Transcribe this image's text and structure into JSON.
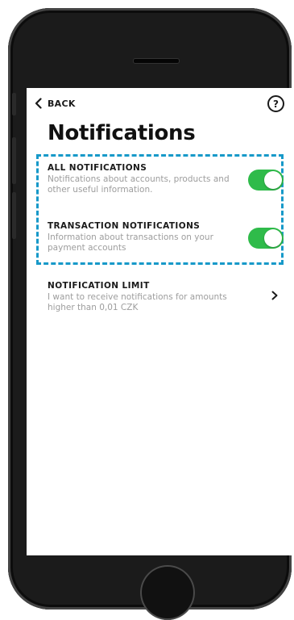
{
  "header": {
    "back_label": "BACK",
    "help_symbol": "?",
    "title": "Notifications"
  },
  "settings": [
    {
      "title": "ALL NOTIFICATIONS",
      "description": "Notifications about accounts, products and other useful information.",
      "control": "toggle",
      "enabled": true
    },
    {
      "title": "TRANSACTION NOTIFICATIONS",
      "description": "Information about transactions on your payment accounts",
      "control": "toggle",
      "enabled": true
    },
    {
      "title": "NOTIFICATION LIMIT",
      "description": "I want to receive notifications for amounts higher than 0,01 CZK",
      "control": "chevron-right-icon"
    }
  ],
  "colors": {
    "toggle_on": "#2fbb4a",
    "highlight_border": "#1799c9",
    "text_primary": "#1a1a1a",
    "text_secondary": "#9d9d9d"
  },
  "icons": {
    "back": "chevron-left-icon",
    "help": "question-circle-icon",
    "row_action": "chevron-right-icon"
  }
}
